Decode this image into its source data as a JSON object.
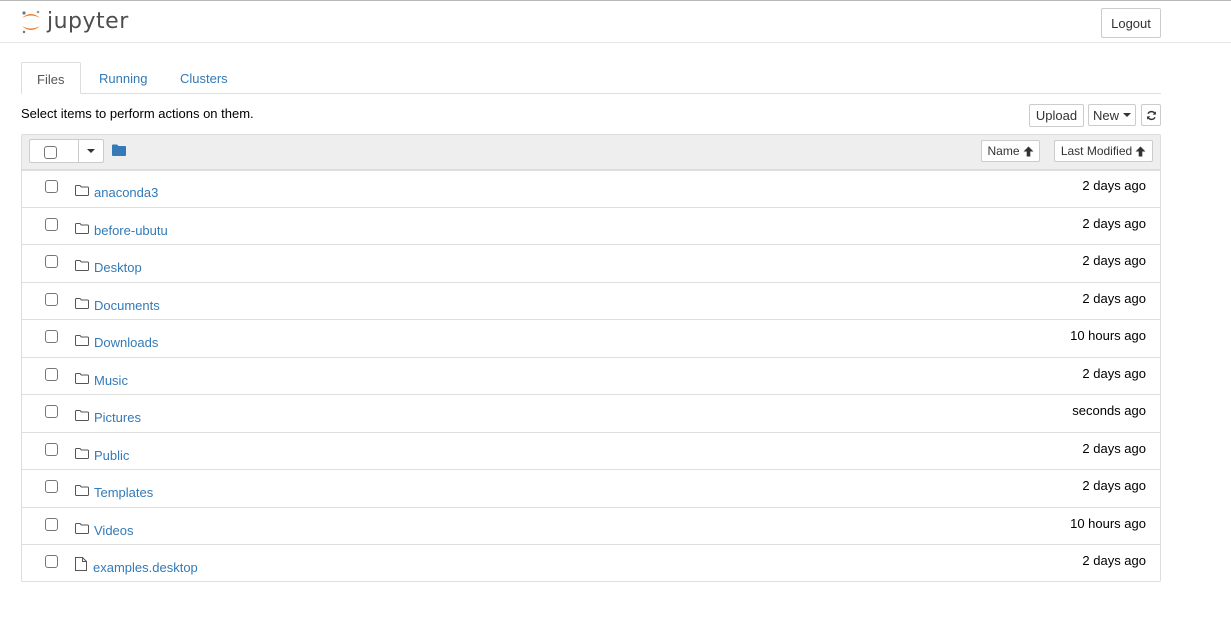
{
  "app": {
    "logo_text": "jupyter"
  },
  "header": {
    "logout_label": "Logout"
  },
  "tabs": [
    {
      "label": "Files"
    },
    {
      "label": "Running"
    },
    {
      "label": "Clusters"
    }
  ],
  "toolbar": {
    "instructions": "Select items to perform actions on them.",
    "upload_label": "Upload",
    "new_label": "New"
  },
  "list_header": {
    "name_label": "Name",
    "modified_label": "Last Modified"
  },
  "items": [
    {
      "name": "anaconda3",
      "type": "folder",
      "modified": "2 days ago"
    },
    {
      "name": "before-ubutu",
      "type": "folder",
      "modified": "2 days ago"
    },
    {
      "name": "Desktop",
      "type": "folder",
      "modified": "2 days ago"
    },
    {
      "name": "Documents",
      "type": "folder",
      "modified": "2 days ago"
    },
    {
      "name": "Downloads",
      "type": "folder",
      "modified": "10 hours ago"
    },
    {
      "name": "Music",
      "type": "folder",
      "modified": "2 days ago"
    },
    {
      "name": "Pictures",
      "type": "folder",
      "modified": "seconds ago"
    },
    {
      "name": "Public",
      "type": "folder",
      "modified": "2 days ago"
    },
    {
      "name": "Templates",
      "type": "folder",
      "modified": "2 days ago"
    },
    {
      "name": "Videos",
      "type": "folder",
      "modified": "10 hours ago"
    },
    {
      "name": "examples.desktop",
      "type": "file",
      "modified": "2 days ago"
    }
  ],
  "colors": {
    "link": "#337ab7",
    "logo_orange": "#f37626"
  }
}
